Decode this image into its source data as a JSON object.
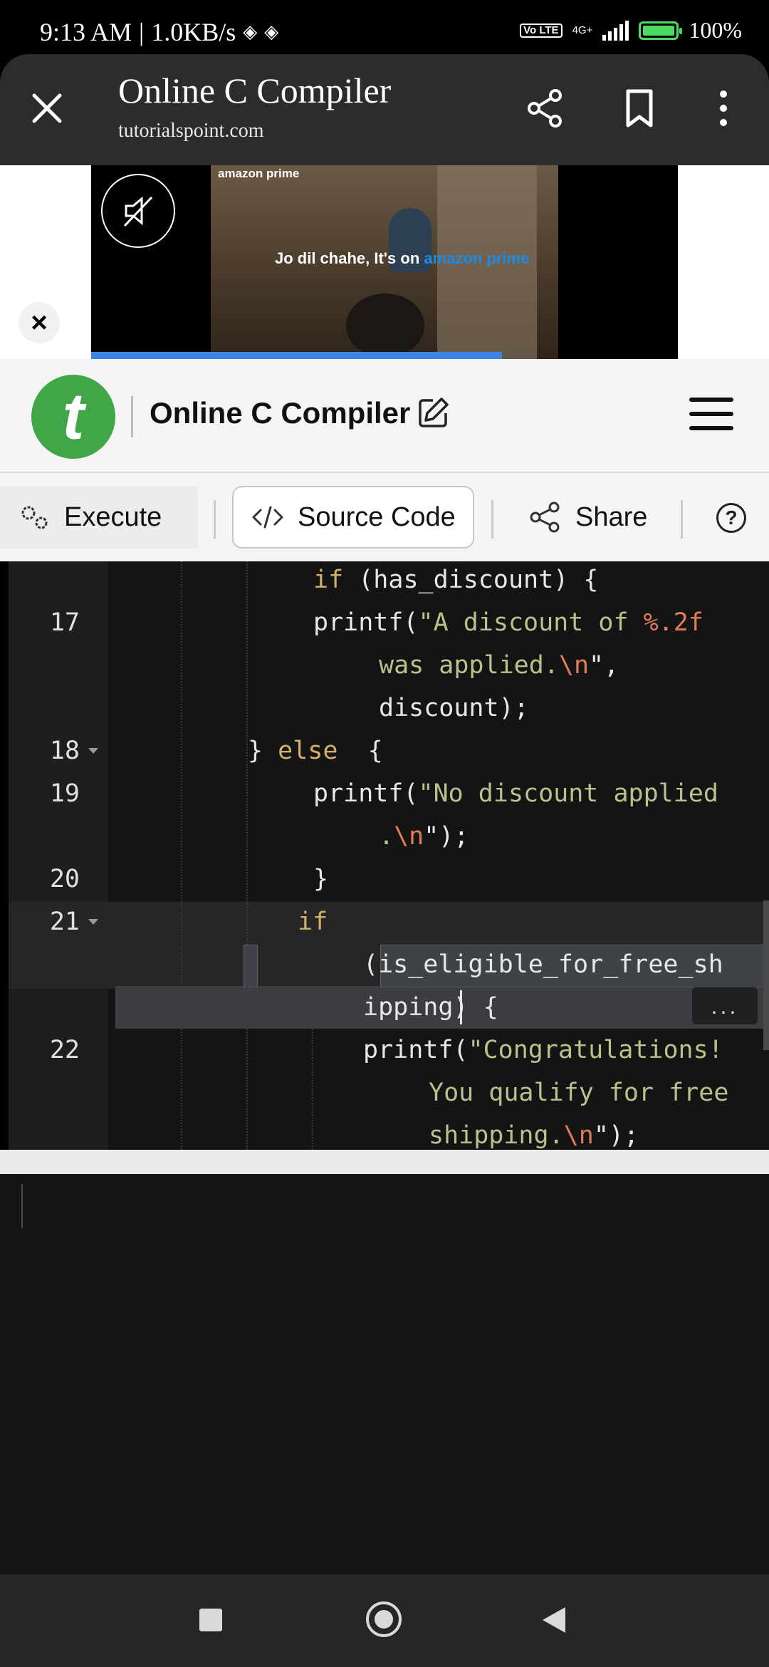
{
  "status_bar": {
    "time": "9:13 AM",
    "separator": "|",
    "speed": "1.0KB/s",
    "volte": "Vo LTE",
    "network": "4G+",
    "battery": "100%",
    "battery_level": 1.0
  },
  "browser": {
    "title": "Online C Compiler",
    "url": "tutorialspoint.com",
    "icons": [
      "close-icon",
      "share-icon",
      "bookmark-icon",
      "more-vert-icon"
    ]
  },
  "ad": {
    "brand": "amazon prime",
    "tagline": "Jo dil chahe, It's on",
    "tagline_brand": "amazon prime",
    "close_label": "×",
    "progress": 0.7
  },
  "site": {
    "title": "Online C Compiler"
  },
  "toolbar": {
    "execute": "Execute",
    "source_code": "Source Code",
    "share": "Share",
    "help": "?"
  },
  "editor": {
    "lines": [
      {
        "num": "",
        "code": "if (has_discount) {"
      },
      {
        "num": "17",
        "code_a": "printf(",
        "code_b": "\"A discount of ",
        "code_c": "%.2f"
      },
      {
        "num": "",
        "code_a": "was applied.",
        "code_b": "\\n",
        "code_c": "\","
      },
      {
        "num": "",
        "code": "discount);"
      },
      {
        "num": "18",
        "code_a": "} ",
        "code_b": "else",
        "code_c": "  {"
      },
      {
        "num": "19",
        "code_a": "printf(",
        "code_b": "\"No discount applied"
      },
      {
        "num": "",
        "code_a": ".",
        "code_b": "\\n",
        "code_c": "\");"
      },
      {
        "num": "20",
        "code": "}"
      },
      {
        "num": "21",
        "code": "if"
      },
      {
        "num": "",
        "code": "(is_eligible_for_free_sh"
      },
      {
        "num": "",
        "code": "ipping) {"
      },
      {
        "num": "22",
        "code_a": "printf(",
        "code_b": "\"Congratulations!"
      },
      {
        "num": "",
        "code": "You qualify for free"
      },
      {
        "num": "",
        "code_a": "shipping.",
        "code_b": "\\n",
        "code_c": "\");"
      }
    ],
    "more_label": "..."
  }
}
